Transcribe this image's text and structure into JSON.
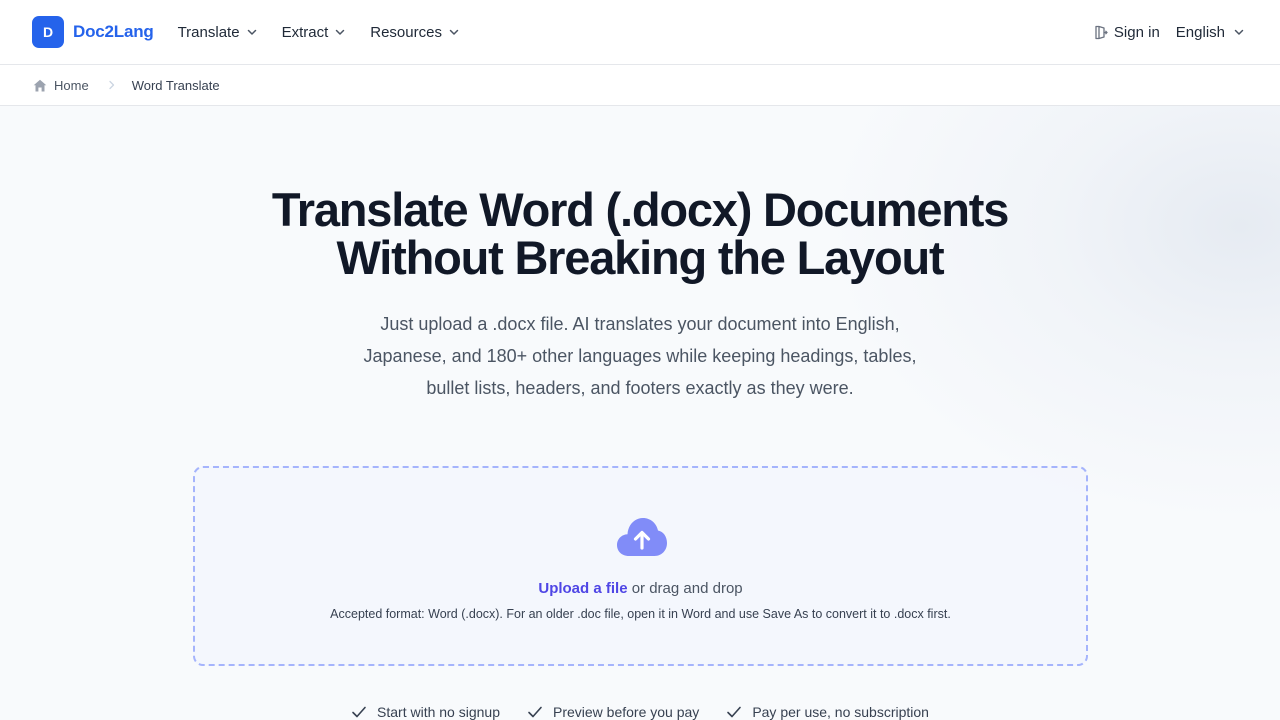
{
  "header": {
    "brand_letter": "D",
    "brand_name": "Doc2Lang",
    "nav": [
      {
        "label": "Translate",
        "icon": "chevron-down-icon"
      },
      {
        "label": "Extract",
        "icon": "chevron-down-icon"
      },
      {
        "label": "Resources",
        "icon": "chevron-down-icon"
      }
    ],
    "sign_in": "Sign in",
    "language": "English"
  },
  "breadcrumb": {
    "home": "Home",
    "current": "Word Translate"
  },
  "hero": {
    "title_line1": "Translate Word (.docx) Documents",
    "title_line2": "Without Breaking the Layout",
    "subtitle": "Just upload a .docx file. AI translates your document into English, Japanese, and 180+ other languages while keeping headings, tables, bullet lists, headers, and footers exactly as they were."
  },
  "upload": {
    "link_text": "Upload a file",
    "drag_text": " or drag and drop",
    "accepted": "Accepted format: Word (.docx). For an older .doc file, open it in Word and use Save As to convert it to .docx first."
  },
  "features": [
    "Start with no signup",
    "Preview before you pay",
    "Pay per use, no subscription"
  ],
  "colors": {
    "brand": "#2563eb",
    "link": "#4f46e5",
    "dropzone_border": "#a5b4fc",
    "cloud": "#818cf8"
  }
}
